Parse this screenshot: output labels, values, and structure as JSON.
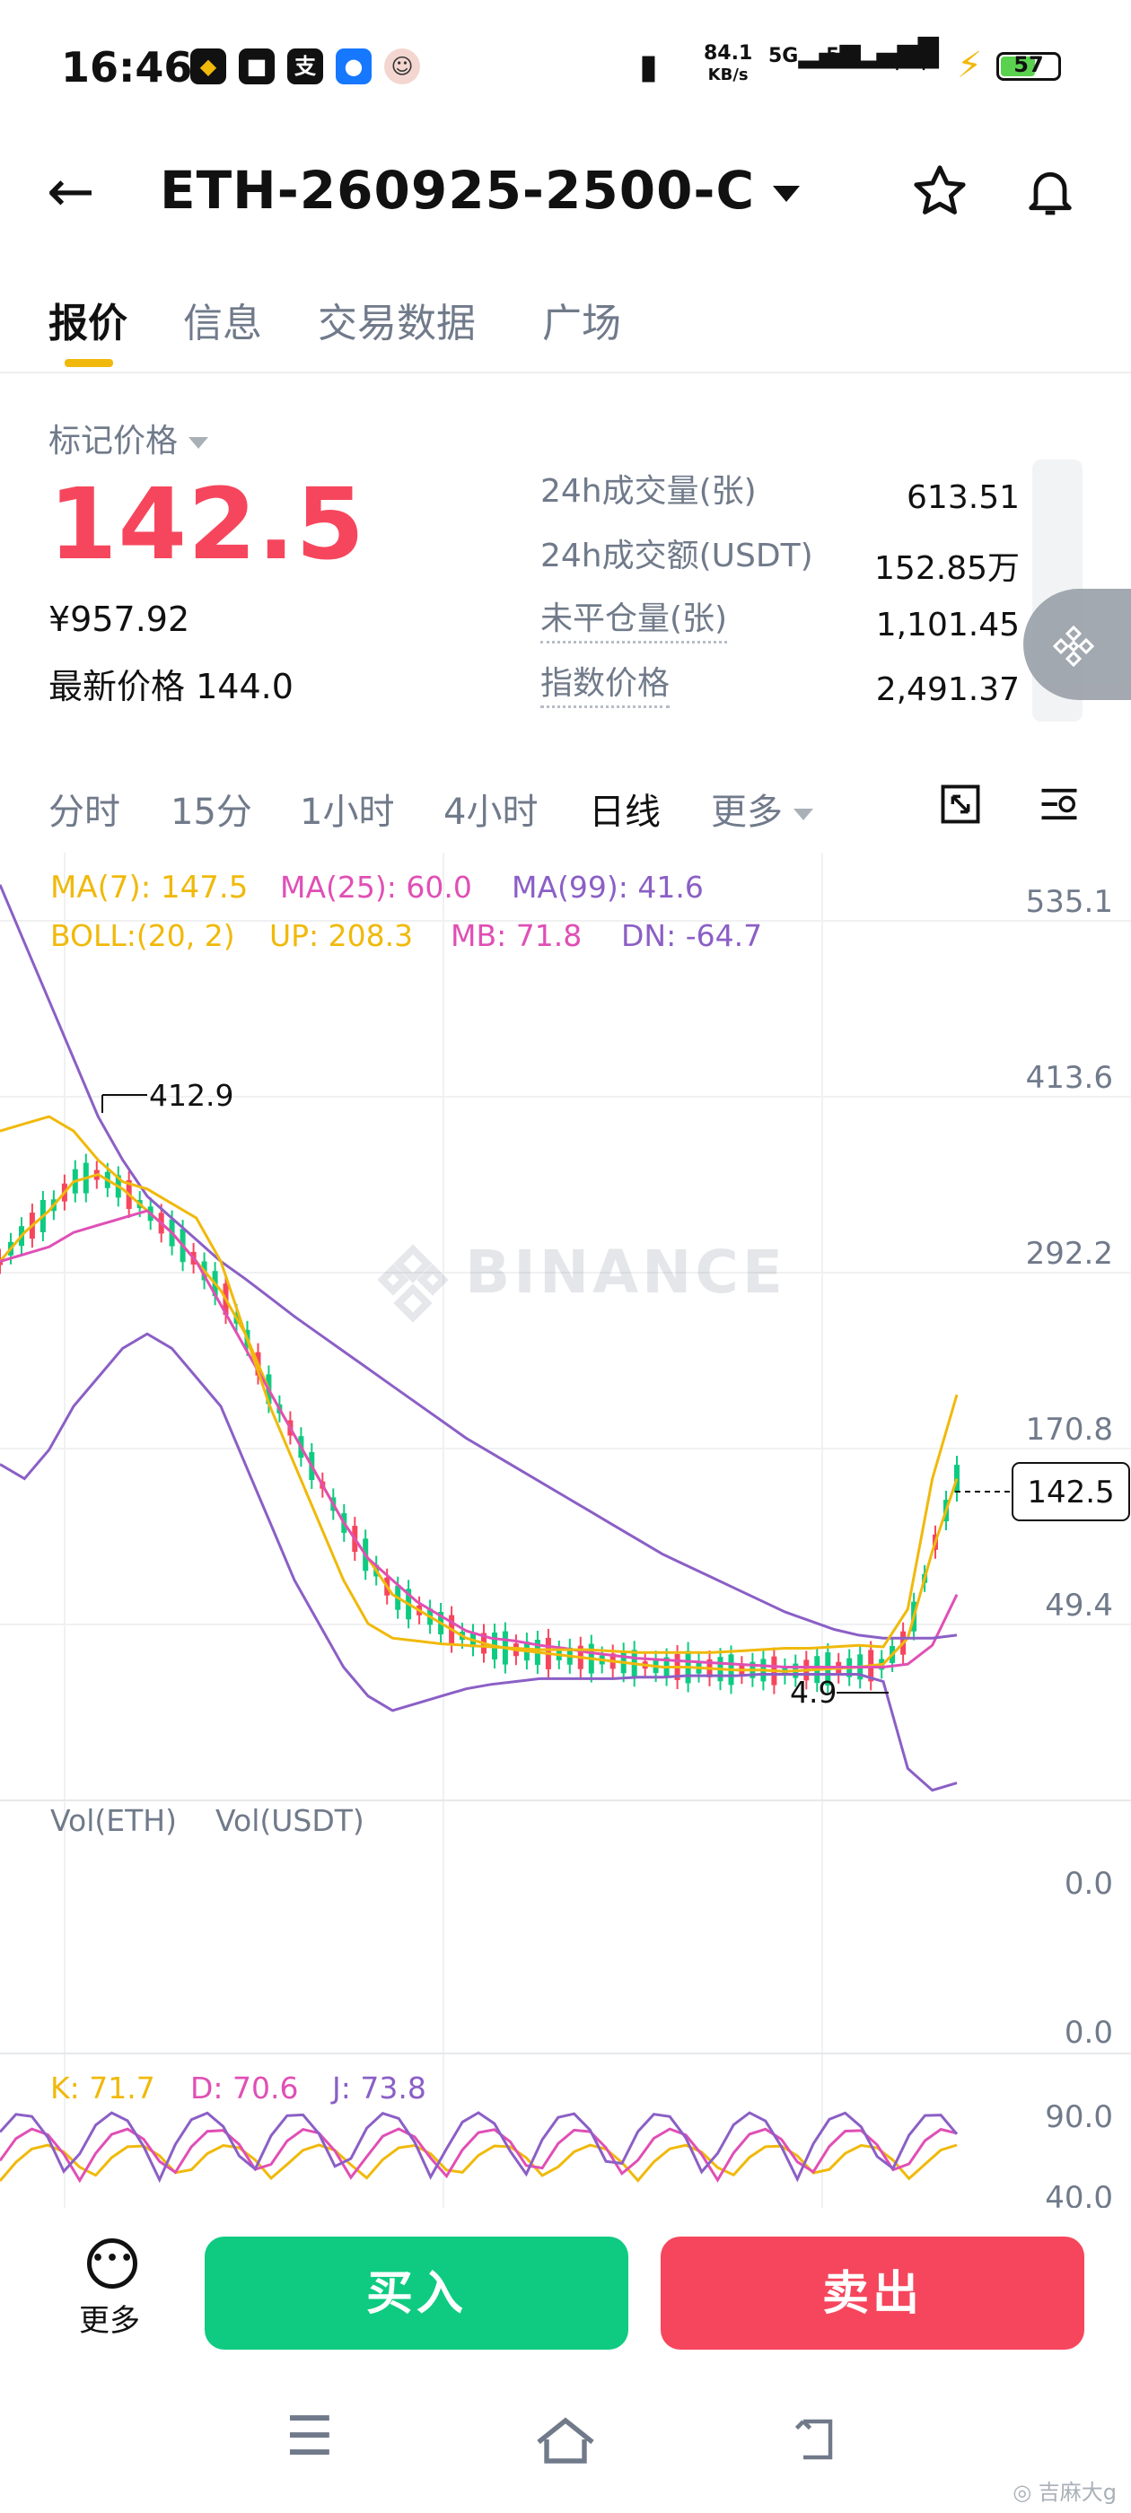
{
  "status_bar": {
    "time": "16:46",
    "net_speed_value": "84.1",
    "net_speed_unit": "KB/s",
    "sim1": "5G",
    "sim2": "5G",
    "battery": "57"
  },
  "header": {
    "symbol": "ETH-260925-2500-C"
  },
  "tabs": [
    "报价",
    "信息",
    "交易数据",
    "广场"
  ],
  "quote": {
    "mark_price_label": "标记价格",
    "mark_price": "142.5",
    "cny_price": "¥957.92",
    "last_price_label": "最新价格",
    "last_price": "144.0",
    "stats": [
      {
        "label": "24h成交量(张)",
        "value": "613.51"
      },
      {
        "label": "24h成交额(USDT)",
        "value": "152.85万"
      },
      {
        "label": "未平仓量(张)",
        "value": "1,101.45"
      },
      {
        "label": "指数价格",
        "value": "2,491.37"
      }
    ]
  },
  "intervals": [
    "分时",
    "15分",
    "1小时",
    "4小时",
    "日线",
    "更多"
  ],
  "chart": {
    "indicators_line1": [
      {
        "text": "MA(7): 147.5",
        "color": "#f0b90b"
      },
      {
        "text": "MA(25): 60.0",
        "color": "#e04fb5"
      },
      {
        "text": "MA(99): 41.6",
        "color": "#8b5fc6"
      }
    ],
    "indicators_line2": [
      {
        "text": "BOLL:(20, 2)",
        "color": "#f0b90b"
      },
      {
        "text": "UP: 208.3",
        "color": "#f0b90b"
      },
      {
        "text": "MB: 71.8",
        "color": "#e04fb5"
      },
      {
        "text": "DN: -64.7",
        "color": "#8b5fc6"
      }
    ],
    "price_axis": [
      "535.1",
      "413.6",
      "292.2",
      "170.8",
      "49.4"
    ],
    "current_price": "142.5",
    "high_label": "412.9",
    "low_label": "4.9",
    "watermark": "BINANCE",
    "vol_labels": [
      "Vol(ETH)",
      "Vol(USDT)"
    ],
    "vol_axis": [
      "0.0",
      "0.0"
    ],
    "kdj": [
      {
        "text": "K: 71.7",
        "color": "#f0b90b"
      },
      {
        "text": "D: 70.6",
        "color": "#e04fb5"
      },
      {
        "text": "J: 73.8",
        "color": "#8b5fc6"
      }
    ],
    "kdj_axis": [
      "90.0",
      "40.0"
    ]
  },
  "chart_data": {
    "type": "line",
    "x_label": "",
    "y_label": "",
    "ylim": [
      -73,
      594
    ],
    "series": [
      {
        "name": "MA(7)",
        "color": "#f0b90b",
        "values": [
          300,
          320,
          335,
          355,
          360,
          350,
          335,
          320,
          300,
          280,
          250,
          210,
          180,
          150,
          120,
          95,
          70,
          60,
          50,
          40,
          35,
          32,
          30,
          28,
          26,
          24,
          22,
          20,
          20,
          19,
          18,
          18,
          17,
          18,
          19,
          20,
          22,
          40,
          100,
          150
        ]
      },
      {
        "name": "MA(25)",
        "color": "#e04fb5",
        "values": [
          300,
          305,
          310,
          320,
          325,
          330,
          335,
          320,
          300,
          270,
          240,
          210,
          180,
          150,
          120,
          95,
          80,
          65,
          55,
          45,
          40,
          38,
          35,
          33,
          30,
          28,
          26,
          25,
          24,
          23,
          22,
          21,
          20,
          20,
          20,
          20,
          20,
          22,
          35,
          70
        ]
      },
      {
        "name": "MA(99)",
        "color": "#8b5fc6",
        "values": [
          560,
          520,
          480,
          440,
          400,
          370,
          345,
          330,
          315,
          300,
          288,
          275,
          262,
          250,
          238,
          226,
          214,
          202,
          190,
          178,
          168,
          158,
          148,
          138,
          128,
          118,
          108,
          98,
          90,
          82,
          74,
          66,
          58,
          52,
          46,
          42,
          40,
          40,
          40,
          42
        ]
      },
      {
        "name": "UP",
        "color": "#f0b90b",
        "values": [
          390,
          395,
          400,
          390,
          370,
          355,
          350,
          340,
          330,
          300,
          250,
          200,
          160,
          120,
          80,
          50,
          40,
          38,
          36,
          35,
          34,
          33,
          32,
          32,
          32,
          31,
          30,
          30,
          30,
          30,
          31,
          32,
          33,
          33,
          34,
          35,
          34,
          60,
          150,
          208
        ]
      },
      {
        "name": "DN",
        "color": "#8b5fc6",
        "values": [
          160,
          150,
          170,
          200,
          220,
          240,
          250,
          240,
          220,
          200,
          160,
          120,
          80,
          50,
          20,
          0,
          -10,
          -5,
          0,
          5,
          8,
          10,
          12,
          12,
          12,
          12,
          13,
          13,
          14,
          14,
          14,
          15,
          15,
          15,
          15,
          15,
          10,
          -50,
          -65,
          -60
        ]
      }
    ]
  }
}
